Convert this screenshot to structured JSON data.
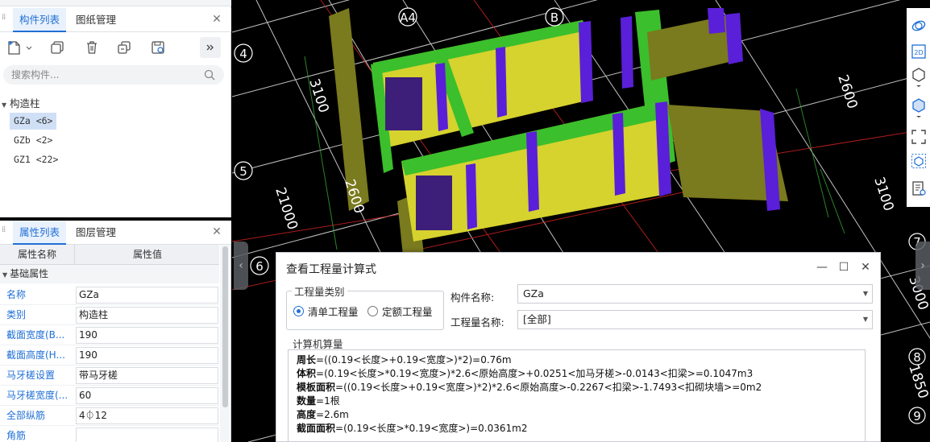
{
  "left_top_panel": {
    "tabs": [
      "构件列表",
      "图纸管理"
    ],
    "search_placeholder": "搜索构件...",
    "tree_root": "构造柱",
    "items": [
      "GZa <6>",
      "GZb <2>",
      "GZ1 <22>"
    ]
  },
  "left_bottom_panel": {
    "tabs": [
      "属性列表",
      "图层管理"
    ],
    "header_name": "属性名称",
    "header_value": "属性值",
    "group": "基础属性",
    "props": [
      {
        "name": "名称",
        "value": "GZa"
      },
      {
        "name": "类别",
        "value": "构造柱"
      },
      {
        "name": "截面宽度(B...",
        "value": "190"
      },
      {
        "name": "截面高度(H...",
        "value": "190"
      },
      {
        "name": "马牙槎设置",
        "value": "带马牙槎"
      },
      {
        "name": "马牙槎宽度(...",
        "value": "60"
      },
      {
        "name": "全部纵筋",
        "value": "4⏀12"
      },
      {
        "name": "角筋",
        "value": ""
      }
    ]
  },
  "viewport": {
    "axis_labels": [
      "A4",
      "B",
      "4",
      "5",
      "6",
      "7",
      "8",
      "9"
    ],
    "dimensions": [
      "3100",
      "2600",
      "2600",
      "21000",
      "3100",
      "3000",
      "1850"
    ]
  },
  "dialog": {
    "title": "查看工程量计算式",
    "qty_type_legend": "工程量类别",
    "radio_list": "清单工程量",
    "radio_quota": "定额工程量",
    "component_label": "构件名称:",
    "component_value": "GZa",
    "qty_name_label": "工程量名称:",
    "qty_name_value": "[全部]",
    "calc_legend": "计算机算量",
    "lines": [
      {
        "key": "周长",
        "expr": "=((0.19<长度>+0.19<宽度>)*2)=0.76m"
      },
      {
        "key": "体积",
        "expr": "=(0.19<长度>*0.19<宽度>)*2.6<原始高度>+0.0251<加马牙槎>-0.0143<扣梁>=0.1047m3"
      },
      {
        "key": "模板面积",
        "expr": "=((0.19<长度>+0.19<宽度>)*2)*2.6<原始高度>-0.2267<扣梁>-1.7493<扣砌块墙>=0m2"
      },
      {
        "key": "数量",
        "expr": "=1根"
      },
      {
        "key": "高度",
        "expr": "=2.6m"
      },
      {
        "key": "截面面积",
        "expr": "=(0.19<长度>*0.19<宽度>)=0.0361m2"
      }
    ]
  },
  "colors": {
    "accent": "#1f6fd6",
    "wall_yellow": "#d6d22e",
    "beam_green": "#3bbf2c",
    "column_purple": "#5a1fd8",
    "olive": "#7a7a1e"
  }
}
